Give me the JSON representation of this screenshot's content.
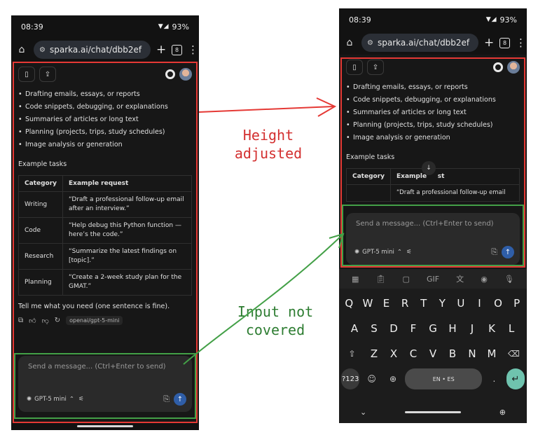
{
  "colors": {
    "highlight_red": "#e53935",
    "highlight_green": "#43a047",
    "accent_blue": "#2f5ea8",
    "enter_key": "#6fc3ae"
  },
  "status": {
    "time": "08:39",
    "battery": "93%"
  },
  "browser": {
    "url": "sparka.ai/chat/dbb2ef",
    "tab_count": "8"
  },
  "chat": {
    "bullets": [
      "Drafting emails, essays, or reports",
      "Code snippets, debugging, or explanations",
      "Summaries of articles or long text",
      "Planning (projects, trips, study schedules)",
      "Image analysis or generation"
    ],
    "section_title": "Example tasks",
    "table": {
      "headers": [
        "Category",
        "Example request"
      ],
      "rows": [
        [
          "Writing",
          "“Draft a professional follow-up email after an interview.”"
        ],
        [
          "Code",
          "“Help debug this Python function — here’s the code.”"
        ],
        [
          "Research",
          "“Summarize the latest findings on [topic].”"
        ],
        [
          "Planning",
          "“Create a 2-week study plan for the GMAT.”"
        ]
      ]
    },
    "right_table": {
      "header_cat": "Category",
      "header_req_a": "Example",
      "header_req_b": "st",
      "peek_text": "“Draft a professional follow-up email"
    },
    "closing": "Tell me what you need (one sentence is fine).",
    "model_tag": "openai/gpt-5-mini"
  },
  "composer": {
    "placeholder": "Send a message... (Ctrl+Enter to send)",
    "model": "GPT-5 mini"
  },
  "keyboard": {
    "suggestions": [
      "GIF"
    ],
    "row1": [
      "Q",
      "W",
      "E",
      "R",
      "T",
      "Y",
      "U",
      "I",
      "O",
      "P"
    ],
    "row1_hints": [
      "1",
      "2",
      "3",
      "4",
      "5",
      "6",
      "7",
      "8",
      "9",
      "0"
    ],
    "row2": [
      "A",
      "S",
      "D",
      "F",
      "G",
      "H",
      "J",
      "K",
      "L"
    ],
    "row3": [
      "Z",
      "X",
      "C",
      "V",
      "B",
      "N",
      "M"
    ],
    "symbols_key": "?123",
    "space_label": "EN • ES"
  },
  "annotations": {
    "height_line1": "Height",
    "height_line2": "adjusted",
    "input_line1": "Input not",
    "input_line2": "covered"
  }
}
